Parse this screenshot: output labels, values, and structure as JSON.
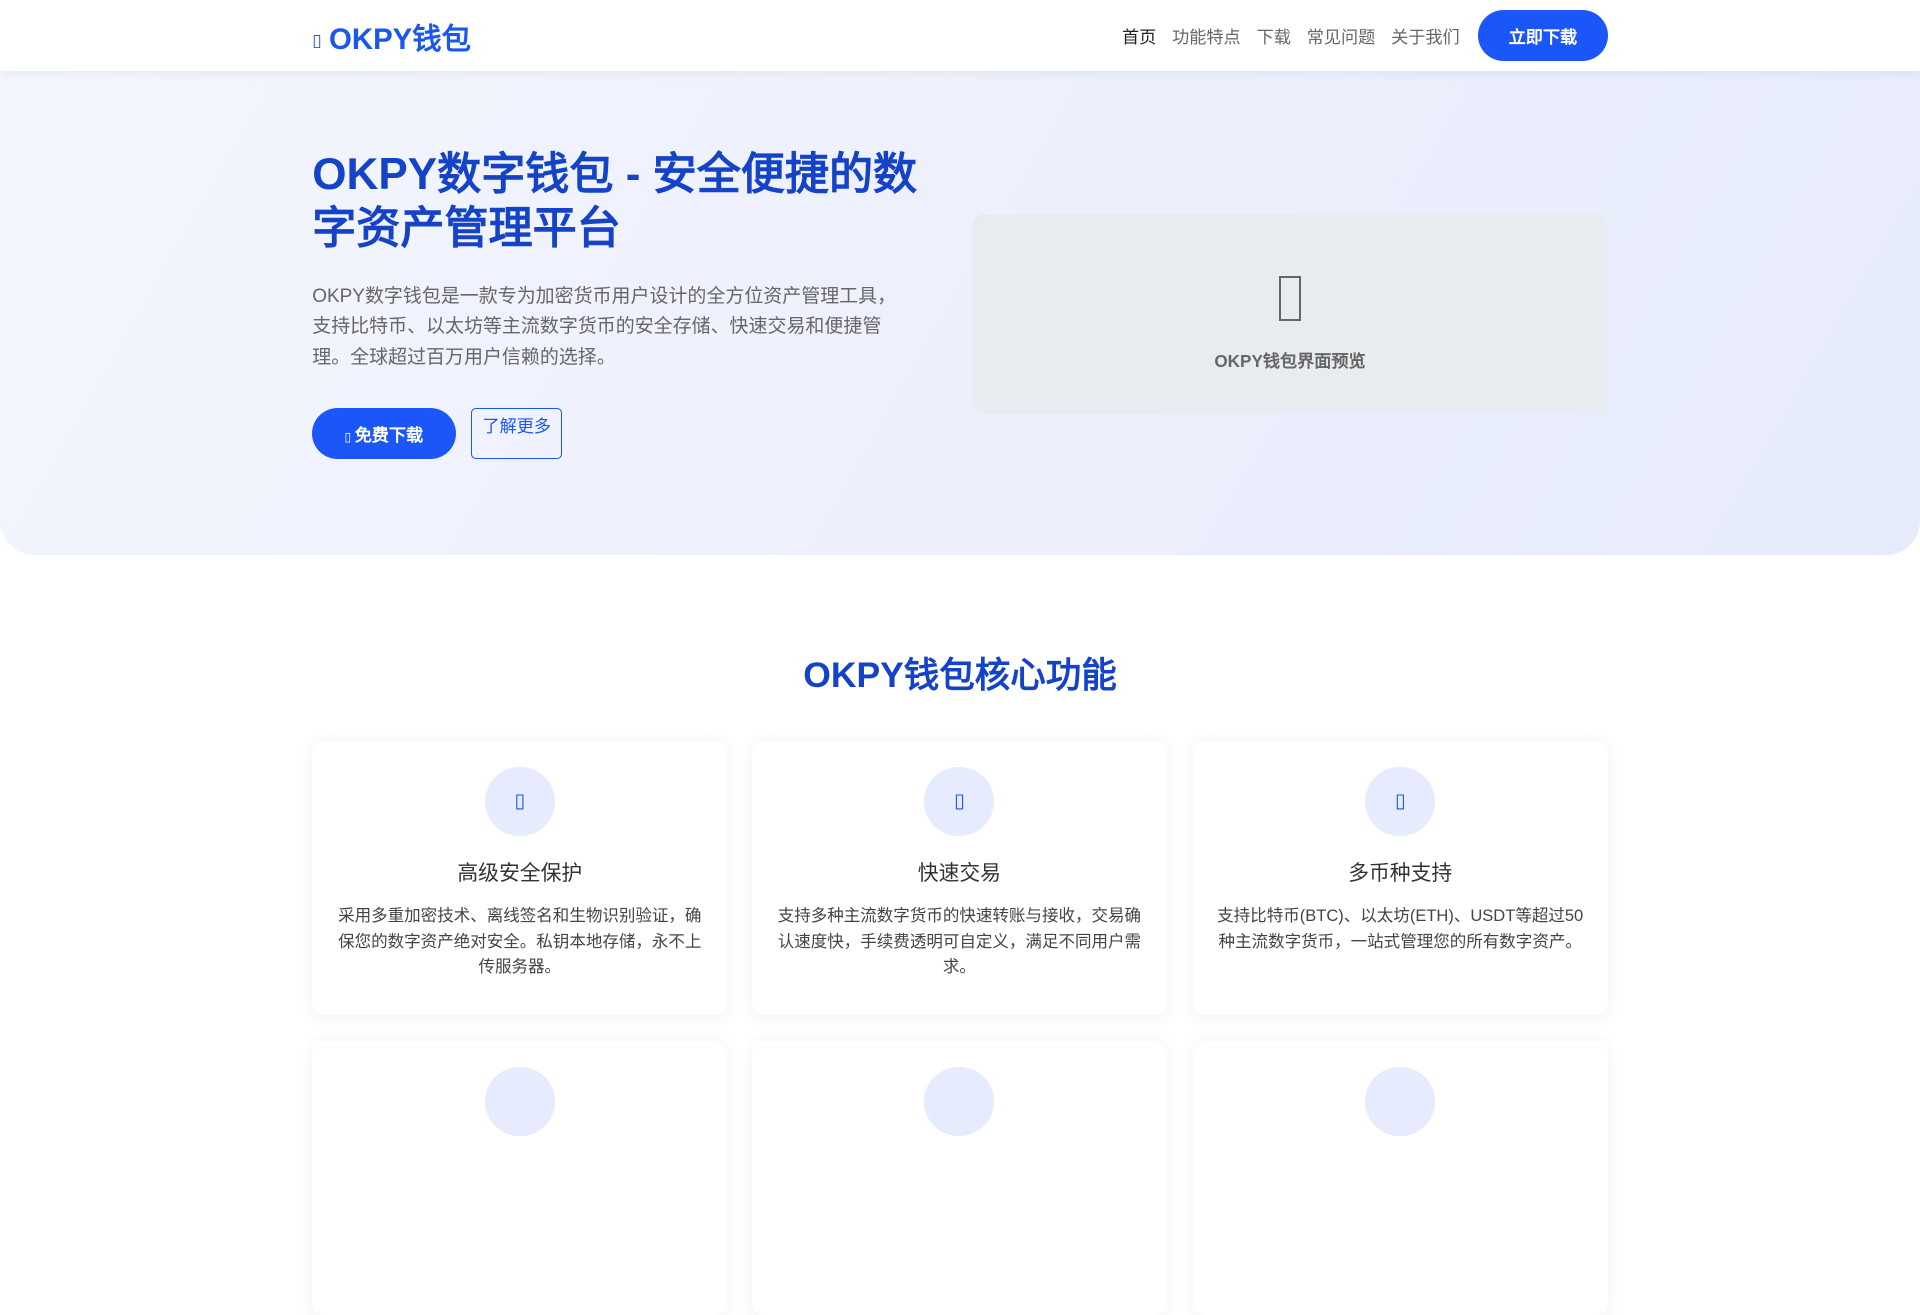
{
  "header": {
    "logo_icon": "wallet-icon",
    "logo_text": "OKPY钱包",
    "nav": [
      {
        "label": "首页",
        "active": true
      },
      {
        "label": "功能特点"
      },
      {
        "label": "下载"
      },
      {
        "label": "常见问题"
      },
      {
        "label": "关于我们"
      }
    ],
    "cta": "立即下载"
  },
  "hero": {
    "title": "OKPY数字钱包 - 安全便捷的数字资产管理平台",
    "description": "OKPY数字钱包是一款专为加密货币用户设计的全方位资产管理工具，支持比特币、以太坊等主流数字货币的安全存储、快速交易和便捷管理。全球超过百万用户信赖的选择。",
    "primary_button": "免费下载",
    "secondary_button": "了解更多",
    "preview_label": "OKPY钱包界面预览"
  },
  "features": {
    "title": "OKPY钱包核心功能",
    "cards": [
      {
        "icon": "shield-icon",
        "title": "高级安全保护",
        "text": "采用多重加密技术、离线签名和生物识别验证，确保您的数字资产绝对安全。私钥本地存储，永不上传服务器。"
      },
      {
        "icon": "bolt-icon",
        "title": "快速交易",
        "text": "支持多种主流数字货币的快速转账与接收，交易确认速度快，手续费透明可自定义，满足不同用户需求。"
      },
      {
        "icon": "coins-icon",
        "title": "多币种支持",
        "text": "支持比特币(BTC)、以太坊(ETH)、USDT等超过50种主流数字货币，一站式管理您的所有数字资产。"
      }
    ]
  }
}
